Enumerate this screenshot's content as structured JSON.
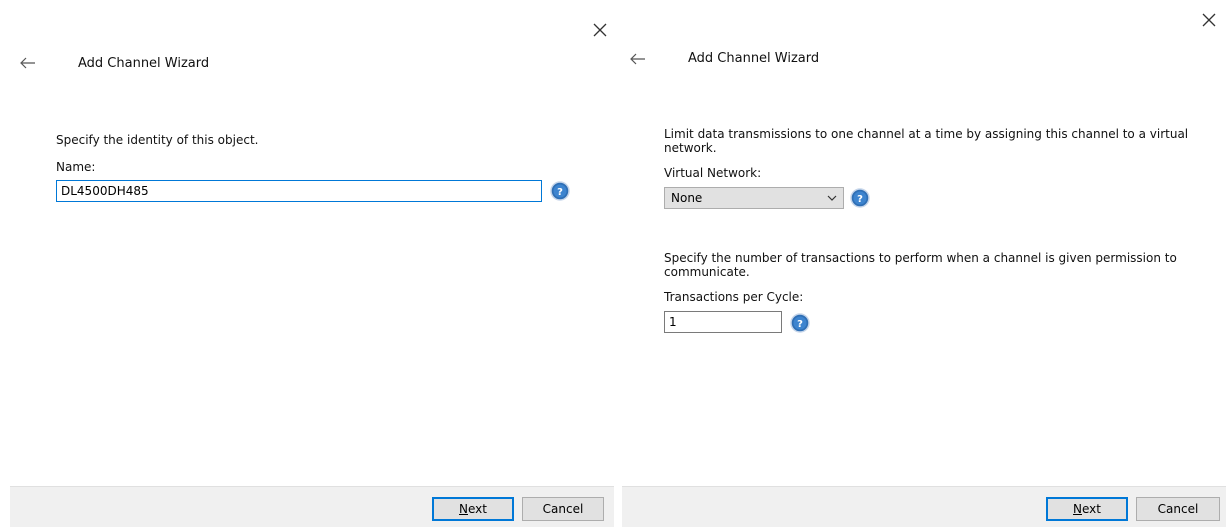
{
  "left": {
    "title": "Add Channel Wizard",
    "identity_text": "Specify the identity of this object.",
    "name_label": "Name:",
    "name_value": "DL4500DH485",
    "next_accel": "N",
    "next_rest": "ext",
    "cancel_label": "Cancel"
  },
  "right": {
    "title": "Add Channel Wizard",
    "vn_text_line1": "Limit data transmissions to one channel at a time by assigning this channel to a virtual",
    "vn_text_line2": "network.",
    "vn_label": "Virtual Network:",
    "vn_selected": "None",
    "tx_text_line1": "Specify the number of transactions to perform when a channel is given permission to",
    "tx_text_line2": "communicate.",
    "tx_label": "Transactions per Cycle:",
    "tx_value": "1",
    "next_accel": "N",
    "next_rest": "ext",
    "cancel_label": "Cancel"
  },
  "icons": {
    "close": "close-icon",
    "back": "back-arrow-icon",
    "help": "help-icon",
    "dropdown": "chevron-down-icon"
  },
  "colors": {
    "accent": "#0078d7",
    "help_blue": "#2f6fb5",
    "footer_bg": "#f0f0f0",
    "button_bg": "#e1e1e1"
  }
}
